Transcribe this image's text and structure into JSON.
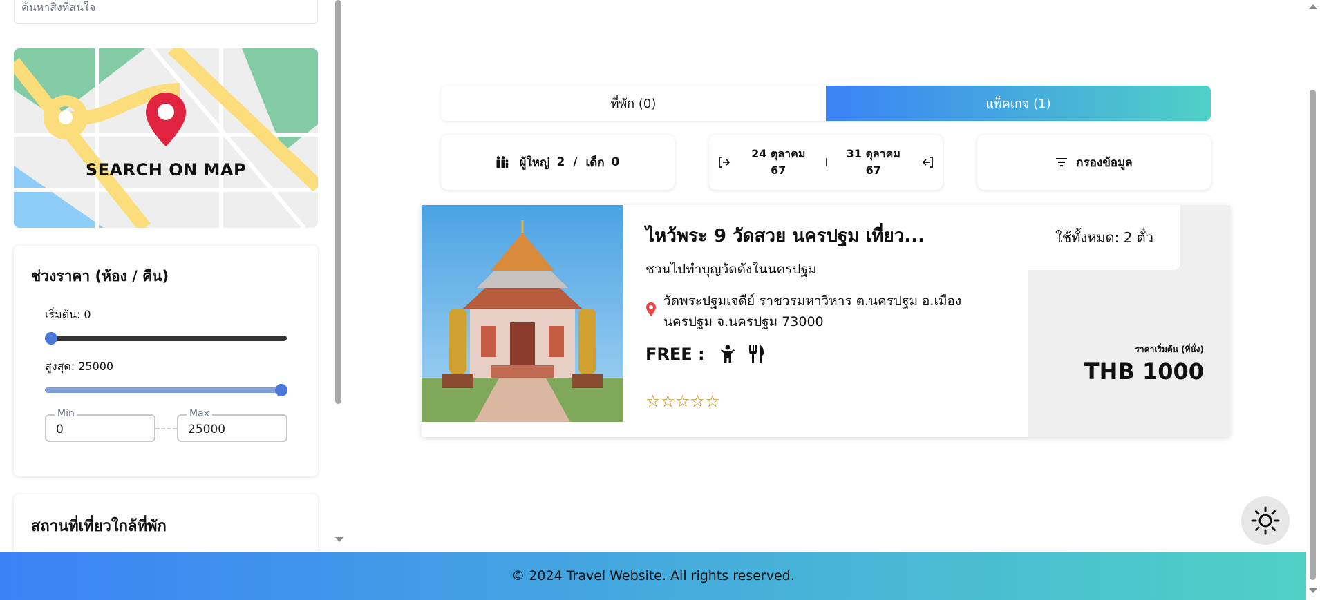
{
  "sidebar": {
    "search_placeholder": "ค้นหาสิ่งที่สนใจ",
    "map_button": "SEARCH ON MAP",
    "price_filter": {
      "title": "ช่วงราคา (ห้อง / คืน)",
      "start_label": "เริ่มต้น: 0",
      "max_label": "สูงสุด: 25000",
      "min_field_label": "Min",
      "min_value": "0",
      "max_field_label": "Max",
      "max_value": "25000",
      "min_fraction": 0,
      "max_fraction": 1
    },
    "nearby_title": "สถานที่เที่ยวใกล้ที่พัก"
  },
  "tabs": [
    {
      "label": "ที่พัก (0)",
      "active": false
    },
    {
      "label": "แพ็คเกจ (1)",
      "active": true
    }
  ],
  "search_bar": {
    "guests": {
      "adults_label": "ผู้ใหญ่",
      "adults_count": "2",
      "separator": "/",
      "children_label": "เด็ก",
      "children_count": "0"
    },
    "checkin_line1": "24 ตุลาคม",
    "checkin_line2": "67",
    "checkout_line1": "31 ตุลาคม",
    "checkout_line2": "67",
    "filter_label": "กรองข้อมูล"
  },
  "result": {
    "title": "ไหว้พระ 9 วัดสวย นครปฐม เที่ยว...",
    "subtitle": "ชวนไปทำบุญวัดดังในนครปฐม",
    "address": "วัดพระปฐมเจดีย์ ราชวรมหาวิหาร ต.นครปฐม อ.เมือง นครปฐม จ.นครปฐม 73000",
    "free_label": "FREE :",
    "amenity_icons": [
      "child-icon",
      "fork-knife-icon"
    ],
    "rating": 0,
    "max_rating": 5,
    "usage": "ใช้ทั้งหมด: 2 ตั๋ว",
    "price_caption": "ราคาเริ่มต้น (ที่นั่ง)",
    "price": "THB 1000"
  },
  "footer": {
    "text": "© 2024 Travel Website. All rights reserved."
  },
  "colors": {
    "gradient_start": "#3b82f6",
    "gradient_end": "#4fd1c5",
    "pin_red": "#e0243f",
    "star_gold": "#d08700"
  }
}
